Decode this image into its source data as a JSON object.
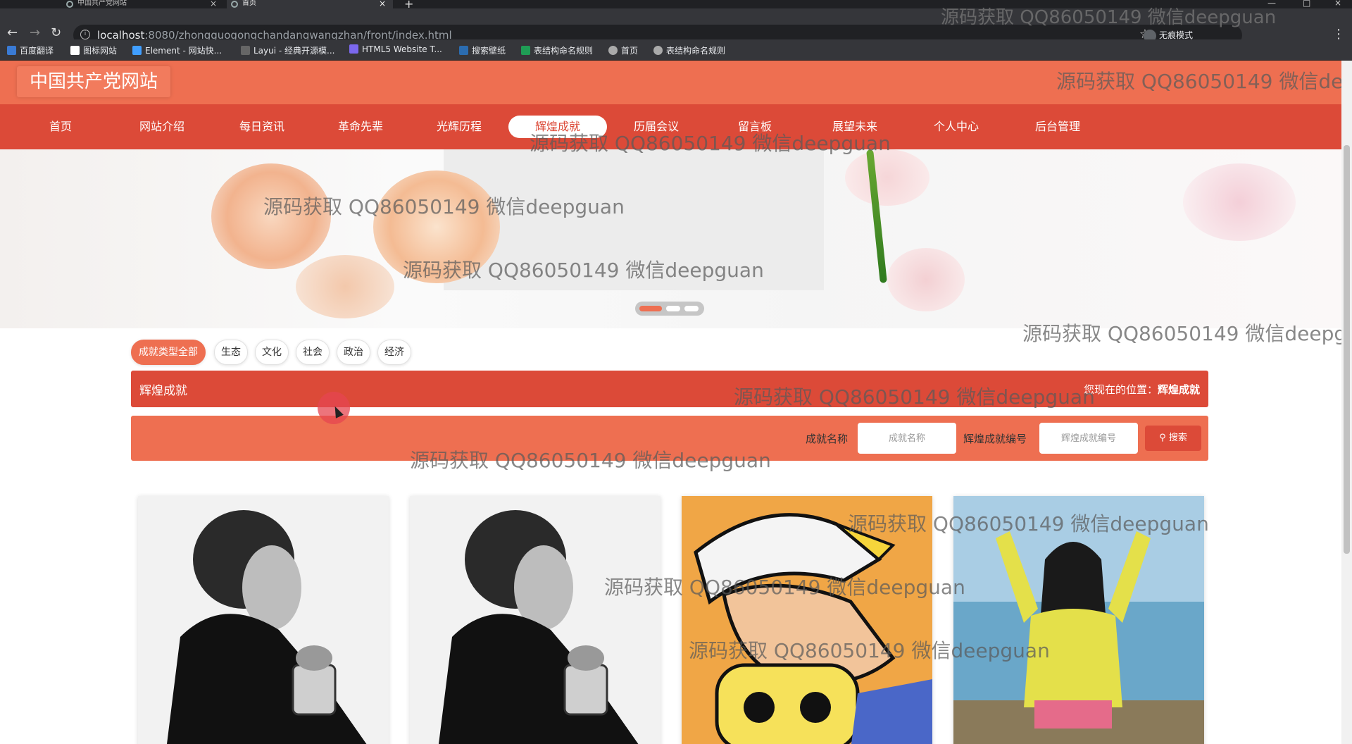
{
  "browser": {
    "tabs": [
      {
        "label": "中国共产党网站",
        "active": false
      },
      {
        "label": "首页",
        "active": true
      }
    ],
    "url_host": "localhost",
    "url_rest": ":8080/zhongguogongchandangwangzhan/front/index.html",
    "profile_label": "无痕模式",
    "bookmarks": [
      "百度翻译",
      "图标网站",
      "Element - 网站快...",
      "Layui - 经典开源模...",
      "HTML5 Website T...",
      "搜索壁纸",
      "表结构命名规则",
      "首页",
      "表结构命名规则"
    ]
  },
  "site": {
    "title": "中国共产党网站",
    "accent": "#ee6f51",
    "nav_color": "#dc4a38"
  },
  "nav": {
    "items": [
      "首页",
      "网站介绍",
      "每日资讯",
      "革命先辈",
      "光辉历程",
      "辉煌成就",
      "历届会议",
      "留言板",
      "展望未来",
      "个人中心",
      "后台管理"
    ],
    "active": "辉煌成就"
  },
  "filters": {
    "items": [
      "成就类型全部",
      "生态",
      "文化",
      "社会",
      "政治",
      "经济"
    ],
    "active": "成就类型全部"
  },
  "breadcrumb": {
    "title": "辉煌成就",
    "position_prefix": "您现在的位置：",
    "position_value": "辉煌成就"
  },
  "search": {
    "name_label": "成就名称",
    "name_placeholder": "成就名称",
    "code_label": "辉煌成就编号",
    "code_placeholder": "辉煌成就编号",
    "button_label": "搜索"
  },
  "watermark": "源码获取 QQ86050149 微信deepguan"
}
